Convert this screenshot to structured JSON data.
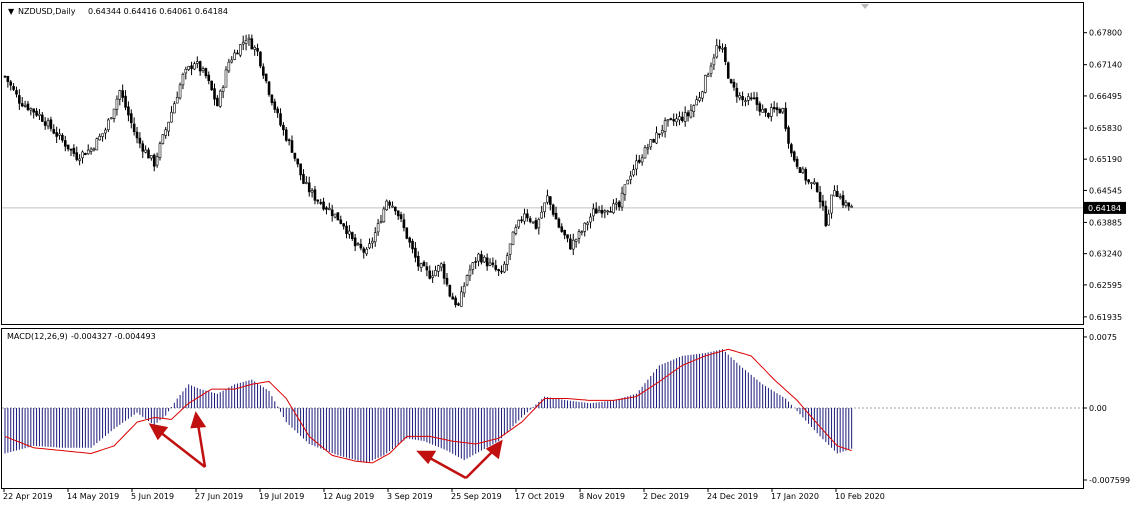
{
  "header": {
    "symbol_timeframe": "NZDUSD,Daily",
    "ohlc": "0.64344 0.64416 0.64061 0.64184",
    "current_price": "0.64184"
  },
  "macd_header": {
    "name": "MACD(12,26,9)",
    "values": "-0.004327 -0.004493"
  },
  "colors": {
    "bull_body": "#ffffff",
    "bear_body": "#000000",
    "histogram": "#1a1a7a",
    "signal_line": "#dd0000",
    "arrows": "#c0100f",
    "price_line": "#c0c0c0"
  },
  "chart_data": [
    {
      "type": "candlestick",
      "title": "NZDUSD,Daily",
      "y_ticks": [
        "0.67800",
        "0.67140",
        "0.66495",
        "0.65830",
        "0.65190",
        "0.64545",
        "0.63885",
        "0.63240",
        "0.62595",
        "0.61935"
      ],
      "ylim": [
        0.6185,
        0.68
      ],
      "current_price": 0.64184,
      "x_ticks": [
        "22 Apr 2019",
        "14 May 2019",
        "5 Jun 2019",
        "27 Jun 2019",
        "19 Jul 2019",
        "12 Aug 2019",
        "3 Sep 2019",
        "25 Sep 2019",
        "17 Oct 2019",
        "8 Nov 2019",
        "2 Dec 2019",
        "24 Dec 2019",
        "17 Jan 2020",
        "10 Feb 2020"
      ],
      "close_path": [
        {
          "bar": 0,
          "close": 0.669
        },
        {
          "bar": 5,
          "close": 0.664
        },
        {
          "bar": 12,
          "close": 0.661
        },
        {
          "bar": 18,
          "close": 0.657
        },
        {
          "bar": 25,
          "close": 0.6525
        },
        {
          "bar": 30,
          "close": 0.654
        },
        {
          "bar": 35,
          "close": 0.658
        },
        {
          "bar": 40,
          "close": 0.666
        },
        {
          "bar": 46,
          "close": 0.656
        },
        {
          "bar": 52,
          "close": 0.651
        },
        {
          "bar": 56,
          "close": 0.658
        },
        {
          "bar": 62,
          "close": 0.669
        },
        {
          "bar": 66,
          "close": 0.672
        },
        {
          "bar": 70,
          "close": 0.669
        },
        {
          "bar": 74,
          "close": 0.663
        },
        {
          "bar": 78,
          "close": 0.672
        },
        {
          "bar": 84,
          "close": 0.677
        },
        {
          "bar": 88,
          "close": 0.674
        },
        {
          "bar": 92,
          "close": 0.666
        },
        {
          "bar": 96,
          "close": 0.659
        },
        {
          "bar": 100,
          "close": 0.654
        },
        {
          "bar": 104,
          "close": 0.647
        },
        {
          "bar": 108,
          "close": 0.644
        },
        {
          "bar": 113,
          "close": 0.6415
        },
        {
          "bar": 118,
          "close": 0.6385
        },
        {
          "bar": 122,
          "close": 0.634
        },
        {
          "bar": 126,
          "close": 0.6325
        },
        {
          "bar": 130,
          "close": 0.638
        },
        {
          "bar": 133,
          "close": 0.6435
        },
        {
          "bar": 136,
          "close": 0.642
        },
        {
          "bar": 140,
          "close": 0.636
        },
        {
          "bar": 144,
          "close": 0.63
        },
        {
          "bar": 148,
          "close": 0.628
        },
        {
          "bar": 152,
          "close": 0.63
        },
        {
          "bar": 155,
          "close": 0.624
        },
        {
          "bar": 158,
          "close": 0.6215
        },
        {
          "bar": 161,
          "close": 0.628
        },
        {
          "bar": 165,
          "close": 0.632
        },
        {
          "bar": 169,
          "close": 0.63
        },
        {
          "bar": 173,
          "close": 0.628
        },
        {
          "bar": 177,
          "close": 0.636
        },
        {
          "bar": 181,
          "close": 0.641
        },
        {
          "bar": 185,
          "close": 0.638
        },
        {
          "bar": 189,
          "close": 0.644
        },
        {
          "bar": 193,
          "close": 0.638
        },
        {
          "bar": 197,
          "close": 0.634
        },
        {
          "bar": 201,
          "close": 0.637
        },
        {
          "bar": 205,
          "close": 0.641
        },
        {
          "bar": 210,
          "close": 0.642
        },
        {
          "bar": 214,
          "close": 0.642
        },
        {
          "bar": 217,
          "close": 0.648
        },
        {
          "bar": 221,
          "close": 0.652
        },
        {
          "bar": 226,
          "close": 0.656
        },
        {
          "bar": 230,
          "close": 0.659
        },
        {
          "bar": 234,
          "close": 0.66
        },
        {
          "bar": 238,
          "close": 0.661
        },
        {
          "bar": 242,
          "close": 0.665
        },
        {
          "bar": 245,
          "close": 0.67
        },
        {
          "bar": 248,
          "close": 0.675
        },
        {
          "bar": 250,
          "close": 0.674
        },
        {
          "bar": 253,
          "close": 0.667
        },
        {
          "bar": 257,
          "close": 0.664
        },
        {
          "bar": 261,
          "close": 0.664
        },
        {
          "bar": 265,
          "close": 0.661
        },
        {
          "bar": 268,
          "close": 0.662
        },
        {
          "bar": 271,
          "close": 0.662
        },
        {
          "bar": 274,
          "close": 0.653
        },
        {
          "bar": 277,
          "close": 0.65
        },
        {
          "bar": 280,
          "close": 0.647
        },
        {
          "bar": 283,
          "close": 0.646
        },
        {
          "bar": 286,
          "close": 0.639
        },
        {
          "bar": 289,
          "close": 0.646
        },
        {
          "bar": 292,
          "close": 0.643
        },
        {
          "bar": 295,
          "close": 0.6418
        }
      ]
    },
    {
      "type": "bar",
      "title": "MACD(12,26,9)",
      "y_ticks": [
        "0.0075",
        "0.00",
        "-0.007599"
      ],
      "ylim": [
        -0.0076,
        0.0076
      ],
      "zero_line": 0.0,
      "histogram_path": [
        {
          "bar": 0,
          "value": -0.0048
        },
        {
          "bar": 10,
          "value": -0.004
        },
        {
          "bar": 20,
          "value": -0.0042
        },
        {
          "bar": 30,
          "value": -0.0042
        },
        {
          "bar": 38,
          "value": -0.0022
        },
        {
          "bar": 46,
          "value": -0.0005
        },
        {
          "bar": 52,
          "value": -0.0018
        },
        {
          "bar": 56,
          "value": -0.0008
        },
        {
          "bar": 60,
          "value": 0.001
        },
        {
          "bar": 64,
          "value": 0.0025
        },
        {
          "bar": 68,
          "value": 0.002
        },
        {
          "bar": 74,
          "value": 0.0015
        },
        {
          "bar": 80,
          "value": 0.0025
        },
        {
          "bar": 86,
          "value": 0.003
        },
        {
          "bar": 92,
          "value": 0.0018
        },
        {
          "bar": 98,
          "value": -0.0015
        },
        {
          "bar": 106,
          "value": -0.0038
        },
        {
          "bar": 116,
          "value": -0.005
        },
        {
          "bar": 126,
          "value": -0.0058
        },
        {
          "bar": 132,
          "value": -0.005
        },
        {
          "bar": 140,
          "value": -0.0032
        },
        {
          "bar": 146,
          "value": -0.0035
        },
        {
          "bar": 154,
          "value": -0.0045
        },
        {
          "bar": 160,
          "value": -0.0055
        },
        {
          "bar": 166,
          "value": -0.0045
        },
        {
          "bar": 172,
          "value": -0.0035
        },
        {
          "bar": 180,
          "value": -0.001
        },
        {
          "bar": 188,
          "value": 0.0012
        },
        {
          "bar": 196,
          "value": 0.0008
        },
        {
          "bar": 204,
          "value": 0.0005
        },
        {
          "bar": 212,
          "value": 0.0008
        },
        {
          "bar": 220,
          "value": 0.0015
        },
        {
          "bar": 228,
          "value": 0.0045
        },
        {
          "bar": 236,
          "value": 0.0055
        },
        {
          "bar": 244,
          "value": 0.0058
        },
        {
          "bar": 250,
          "value": 0.0062
        },
        {
          "bar": 256,
          "value": 0.0045
        },
        {
          "bar": 264,
          "value": 0.0025
        },
        {
          "bar": 272,
          "value": 0.001
        },
        {
          "bar": 278,
          "value": -0.001
        },
        {
          "bar": 284,
          "value": -0.003
        },
        {
          "bar": 290,
          "value": -0.0048
        },
        {
          "bar": 295,
          "value": -0.0043
        }
      ],
      "signal_path": [
        {
          "bar": 0,
          "value": -0.003
        },
        {
          "bar": 10,
          "value": -0.0042
        },
        {
          "bar": 20,
          "value": -0.0045
        },
        {
          "bar": 30,
          "value": -0.0048
        },
        {
          "bar": 38,
          "value": -0.004
        },
        {
          "bar": 46,
          "value": -0.0015
        },
        {
          "bar": 52,
          "value": -0.001
        },
        {
          "bar": 58,
          "value": -0.0012
        },
        {
          "bar": 64,
          "value": 0.0005
        },
        {
          "bar": 72,
          "value": 0.002
        },
        {
          "bar": 80,
          "value": 0.002
        },
        {
          "bar": 86,
          "value": 0.0025
        },
        {
          "bar": 92,
          "value": 0.0028
        },
        {
          "bar": 98,
          "value": 0.001
        },
        {
          "bar": 106,
          "value": -0.003
        },
        {
          "bar": 114,
          "value": -0.005
        },
        {
          "bar": 122,
          "value": -0.0056
        },
        {
          "bar": 128,
          "value": -0.0058
        },
        {
          "bar": 134,
          "value": -0.0048
        },
        {
          "bar": 140,
          "value": -0.003
        },
        {
          "bar": 148,
          "value": -0.003
        },
        {
          "bar": 156,
          "value": -0.0035
        },
        {
          "bar": 164,
          "value": -0.0038
        },
        {
          "bar": 172,
          "value": -0.0032
        },
        {
          "bar": 180,
          "value": -0.0015
        },
        {
          "bar": 188,
          "value": 0.001
        },
        {
          "bar": 196,
          "value": 0.001
        },
        {
          "bar": 204,
          "value": 0.0008
        },
        {
          "bar": 212,
          "value": 0.0008
        },
        {
          "bar": 220,
          "value": 0.0012
        },
        {
          "bar": 228,
          "value": 0.0028
        },
        {
          "bar": 236,
          "value": 0.0045
        },
        {
          "bar": 244,
          "value": 0.0055
        },
        {
          "bar": 252,
          "value": 0.0062
        },
        {
          "bar": 260,
          "value": 0.0055
        },
        {
          "bar": 268,
          "value": 0.003
        },
        {
          "bar": 276,
          "value": 0.0008
        },
        {
          "bar": 284,
          "value": -0.002
        },
        {
          "bar": 290,
          "value": -0.004
        },
        {
          "bar": 295,
          "value": -0.0045
        }
      ]
    }
  ]
}
